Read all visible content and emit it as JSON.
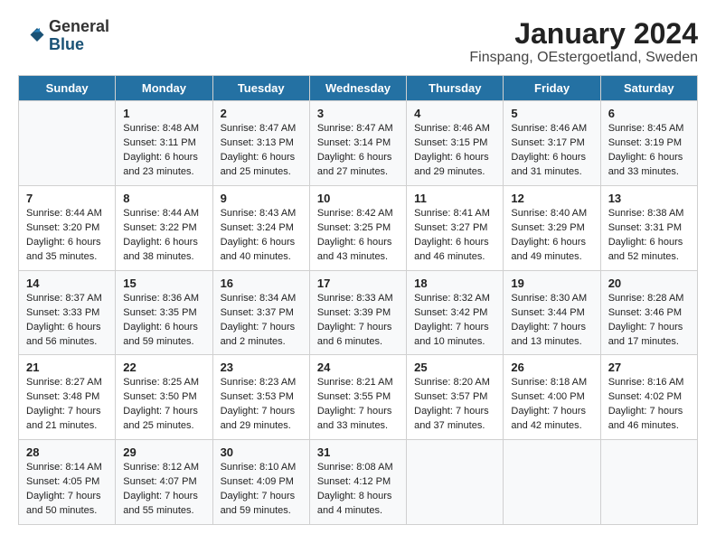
{
  "header": {
    "logo_line1": "General",
    "logo_line2": "Blue",
    "title": "January 2024",
    "subtitle": "Finspang, OEstergoetland, Sweden"
  },
  "columns": [
    "Sunday",
    "Monday",
    "Tuesday",
    "Wednesday",
    "Thursday",
    "Friday",
    "Saturday"
  ],
  "weeks": [
    [
      {
        "day": "",
        "sunrise": "",
        "sunset": "",
        "daylight": ""
      },
      {
        "day": "1",
        "sunrise": "Sunrise: 8:48 AM",
        "sunset": "Sunset: 3:11 PM",
        "daylight": "Daylight: 6 hours and 23 minutes."
      },
      {
        "day": "2",
        "sunrise": "Sunrise: 8:47 AM",
        "sunset": "Sunset: 3:13 PM",
        "daylight": "Daylight: 6 hours and 25 minutes."
      },
      {
        "day": "3",
        "sunrise": "Sunrise: 8:47 AM",
        "sunset": "Sunset: 3:14 PM",
        "daylight": "Daylight: 6 hours and 27 minutes."
      },
      {
        "day": "4",
        "sunrise": "Sunrise: 8:46 AM",
        "sunset": "Sunset: 3:15 PM",
        "daylight": "Daylight: 6 hours and 29 minutes."
      },
      {
        "day": "5",
        "sunrise": "Sunrise: 8:46 AM",
        "sunset": "Sunset: 3:17 PM",
        "daylight": "Daylight: 6 hours and 31 minutes."
      },
      {
        "day": "6",
        "sunrise": "Sunrise: 8:45 AM",
        "sunset": "Sunset: 3:19 PM",
        "daylight": "Daylight: 6 hours and 33 minutes."
      }
    ],
    [
      {
        "day": "7",
        "sunrise": "Sunrise: 8:44 AM",
        "sunset": "Sunset: 3:20 PM",
        "daylight": "Daylight: 6 hours and 35 minutes."
      },
      {
        "day": "8",
        "sunrise": "Sunrise: 8:44 AM",
        "sunset": "Sunset: 3:22 PM",
        "daylight": "Daylight: 6 hours and 38 minutes."
      },
      {
        "day": "9",
        "sunrise": "Sunrise: 8:43 AM",
        "sunset": "Sunset: 3:24 PM",
        "daylight": "Daylight: 6 hours and 40 minutes."
      },
      {
        "day": "10",
        "sunrise": "Sunrise: 8:42 AM",
        "sunset": "Sunset: 3:25 PM",
        "daylight": "Daylight: 6 hours and 43 minutes."
      },
      {
        "day": "11",
        "sunrise": "Sunrise: 8:41 AM",
        "sunset": "Sunset: 3:27 PM",
        "daylight": "Daylight: 6 hours and 46 minutes."
      },
      {
        "day": "12",
        "sunrise": "Sunrise: 8:40 AM",
        "sunset": "Sunset: 3:29 PM",
        "daylight": "Daylight: 6 hours and 49 minutes."
      },
      {
        "day": "13",
        "sunrise": "Sunrise: 8:38 AM",
        "sunset": "Sunset: 3:31 PM",
        "daylight": "Daylight: 6 hours and 52 minutes."
      }
    ],
    [
      {
        "day": "14",
        "sunrise": "Sunrise: 8:37 AM",
        "sunset": "Sunset: 3:33 PM",
        "daylight": "Daylight: 6 hours and 56 minutes."
      },
      {
        "day": "15",
        "sunrise": "Sunrise: 8:36 AM",
        "sunset": "Sunset: 3:35 PM",
        "daylight": "Daylight: 6 hours and 59 minutes."
      },
      {
        "day": "16",
        "sunrise": "Sunrise: 8:34 AM",
        "sunset": "Sunset: 3:37 PM",
        "daylight": "Daylight: 7 hours and 2 minutes."
      },
      {
        "day": "17",
        "sunrise": "Sunrise: 8:33 AM",
        "sunset": "Sunset: 3:39 PM",
        "daylight": "Daylight: 7 hours and 6 minutes."
      },
      {
        "day": "18",
        "sunrise": "Sunrise: 8:32 AM",
        "sunset": "Sunset: 3:42 PM",
        "daylight": "Daylight: 7 hours and 10 minutes."
      },
      {
        "day": "19",
        "sunrise": "Sunrise: 8:30 AM",
        "sunset": "Sunset: 3:44 PM",
        "daylight": "Daylight: 7 hours and 13 minutes."
      },
      {
        "day": "20",
        "sunrise": "Sunrise: 8:28 AM",
        "sunset": "Sunset: 3:46 PM",
        "daylight": "Daylight: 7 hours and 17 minutes."
      }
    ],
    [
      {
        "day": "21",
        "sunrise": "Sunrise: 8:27 AM",
        "sunset": "Sunset: 3:48 PM",
        "daylight": "Daylight: 7 hours and 21 minutes."
      },
      {
        "day": "22",
        "sunrise": "Sunrise: 8:25 AM",
        "sunset": "Sunset: 3:50 PM",
        "daylight": "Daylight: 7 hours and 25 minutes."
      },
      {
        "day": "23",
        "sunrise": "Sunrise: 8:23 AM",
        "sunset": "Sunset: 3:53 PM",
        "daylight": "Daylight: 7 hours and 29 minutes."
      },
      {
        "day": "24",
        "sunrise": "Sunrise: 8:21 AM",
        "sunset": "Sunset: 3:55 PM",
        "daylight": "Daylight: 7 hours and 33 minutes."
      },
      {
        "day": "25",
        "sunrise": "Sunrise: 8:20 AM",
        "sunset": "Sunset: 3:57 PM",
        "daylight": "Daylight: 7 hours and 37 minutes."
      },
      {
        "day": "26",
        "sunrise": "Sunrise: 8:18 AM",
        "sunset": "Sunset: 4:00 PM",
        "daylight": "Daylight: 7 hours and 42 minutes."
      },
      {
        "day": "27",
        "sunrise": "Sunrise: 8:16 AM",
        "sunset": "Sunset: 4:02 PM",
        "daylight": "Daylight: 7 hours and 46 minutes."
      }
    ],
    [
      {
        "day": "28",
        "sunrise": "Sunrise: 8:14 AM",
        "sunset": "Sunset: 4:05 PM",
        "daylight": "Daylight: 7 hours and 50 minutes."
      },
      {
        "day": "29",
        "sunrise": "Sunrise: 8:12 AM",
        "sunset": "Sunset: 4:07 PM",
        "daylight": "Daylight: 7 hours and 55 minutes."
      },
      {
        "day": "30",
        "sunrise": "Sunrise: 8:10 AM",
        "sunset": "Sunset: 4:09 PM",
        "daylight": "Daylight: 7 hours and 59 minutes."
      },
      {
        "day": "31",
        "sunrise": "Sunrise: 8:08 AM",
        "sunset": "Sunset: 4:12 PM",
        "daylight": "Daylight: 8 hours and 4 minutes."
      },
      {
        "day": "",
        "sunrise": "",
        "sunset": "",
        "daylight": ""
      },
      {
        "day": "",
        "sunrise": "",
        "sunset": "",
        "daylight": ""
      },
      {
        "day": "",
        "sunrise": "",
        "sunset": "",
        "daylight": ""
      }
    ]
  ]
}
